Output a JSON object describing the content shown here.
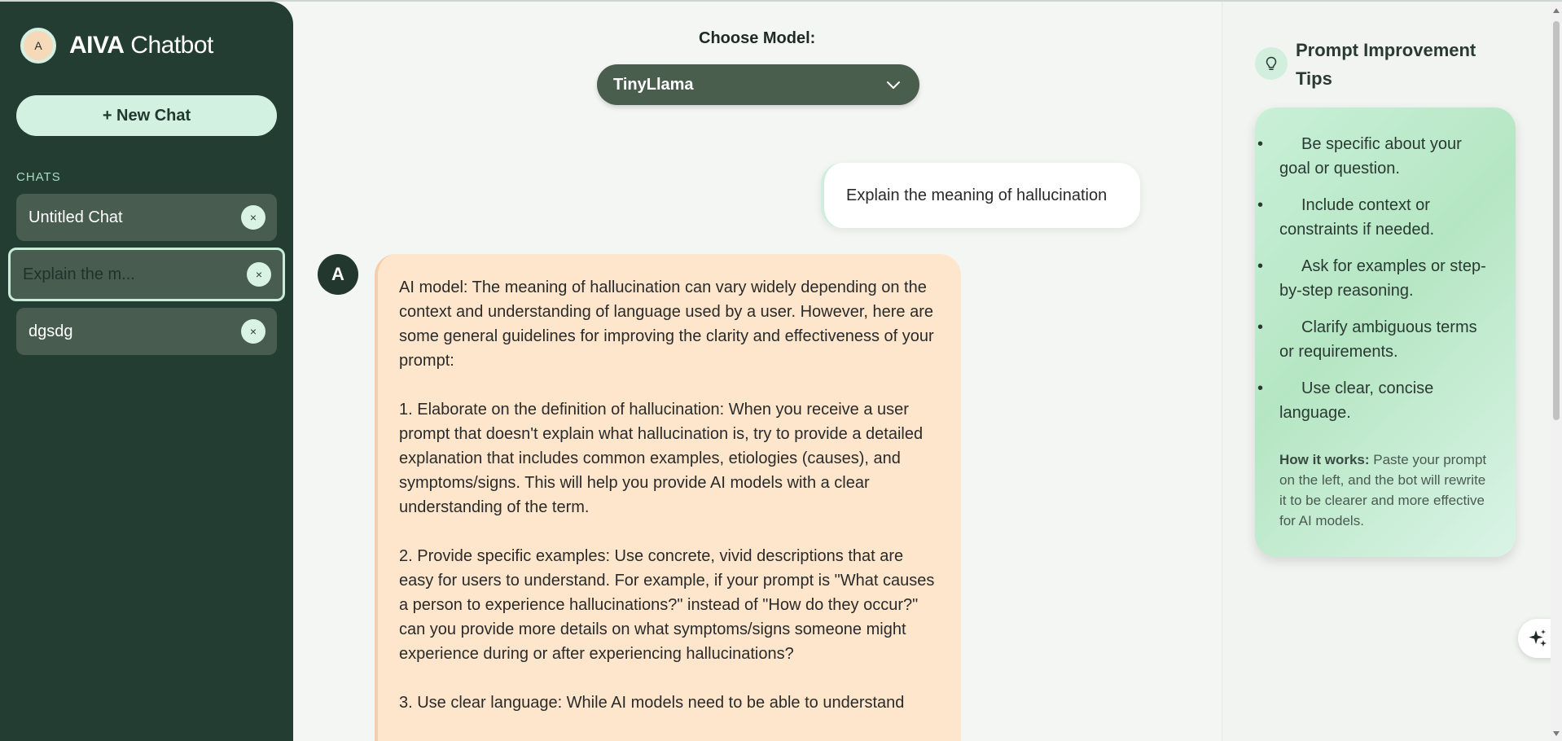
{
  "app": {
    "brand_bold": "AIVA",
    "brand_rest": " Chatbot",
    "avatar_letter": "A"
  },
  "sidebar": {
    "new_chat_label": "+ New Chat",
    "section_label": "CHATS",
    "chats": [
      {
        "label": "Untitled Chat"
      },
      {
        "placeholder": "Explain the m..."
      },
      {
        "label": "dgsdg"
      }
    ],
    "close_glyph": "×"
  },
  "main": {
    "model_label": "Choose Model:",
    "model_selected": "TinyLlama",
    "user_message": "Explain the meaning of hallucination",
    "bot_avatar_letter": "A",
    "bot_message": "AI model: The meaning of hallucination can vary widely depending on the context and understanding of language used by a user. However, here are some general guidelines for improving the clarity and effectiveness of your prompt:\n\n1. Elaborate on the definition of hallucination: When you receive a user prompt that doesn't explain what hallucination is, try to provide a detailed explanation that includes common examples, etiologies (causes), and symptoms/signs. This will help you provide AI models with a clear understanding of the term.\n\n2. Provide specific examples: Use concrete, vivid descriptions that are easy for users to understand. For example, if your prompt is \"What causes a person to experience hallucinations?\" instead of \"How do they occur?\" can you provide more details on what symptoms/signs someone might experience during or after experiencing hallucinations?\n\n3. Use clear language: While AI models need to be able to understand"
  },
  "tips": {
    "title": "Prompt Improvement Tips",
    "items": [
      "Be specific about your goal or question.",
      "Include context or constraints if needed.",
      "Ask for examples or step-by-step reasoning.",
      "Clarify ambiguous terms or requirements.",
      "Use clear, concise language."
    ],
    "how_label": "How it works:",
    "how_text": " Paste your prompt on the left, and the bot will rewrite it to be clearer and more effective for AI models."
  },
  "colors": {
    "sidebar_bg": "#233d33",
    "accent_mint": "#d3f1e0",
    "bot_bubble": "#fde6cc",
    "model_select_bg": "#4a5e4d"
  },
  "icons": {
    "tips": "lightbulb-icon",
    "dropdown": "chevron-down-icon",
    "floating": "sparkle-icon"
  }
}
